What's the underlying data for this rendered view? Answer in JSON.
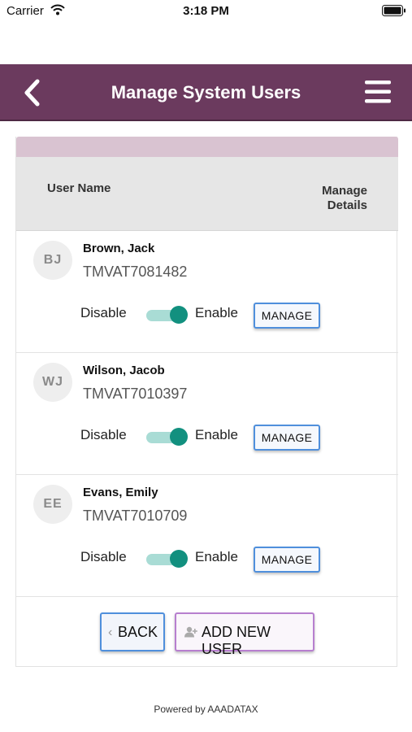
{
  "status_bar": {
    "carrier": "Carrier",
    "time": "3:18 PM"
  },
  "header": {
    "title": "Manage System Users",
    "back_icon": "chevron-left-icon",
    "menu_icon": "hamburger-menu-icon"
  },
  "table": {
    "col_username": "User Name",
    "col_manage_line1": "Manage",
    "col_manage_line2": "Details"
  },
  "users": [
    {
      "initials": "BJ",
      "name": "Brown, Jack",
      "id": "TMVAT7081482",
      "disable_label": "Disable",
      "enable_label": "Enable",
      "enabled": true,
      "manage_label": "MANAGE"
    },
    {
      "initials": "WJ",
      "name": "Wilson, Jacob",
      "id": "TMVAT7010397",
      "disable_label": "Disable",
      "enable_label": "Enable",
      "enabled": true,
      "manage_label": "MANAGE"
    },
    {
      "initials": "EE",
      "name": "Evans, Emily",
      "id": "TMVAT7010709",
      "disable_label": "Disable",
      "enable_label": "Enable",
      "enabled": true,
      "manage_label": "MANAGE"
    }
  ],
  "actions": {
    "back_label": "BACK",
    "add_label": "ADD NEW USER",
    "add_icon": "add-user-icon"
  },
  "footer": {
    "powered_by": "Powered by AAADATAX"
  },
  "colors": {
    "header_bg": "#6b3a5e",
    "toggle_on": "#12907f",
    "manage_border": "#4f8fdc",
    "add_border": "#b77fcf"
  }
}
